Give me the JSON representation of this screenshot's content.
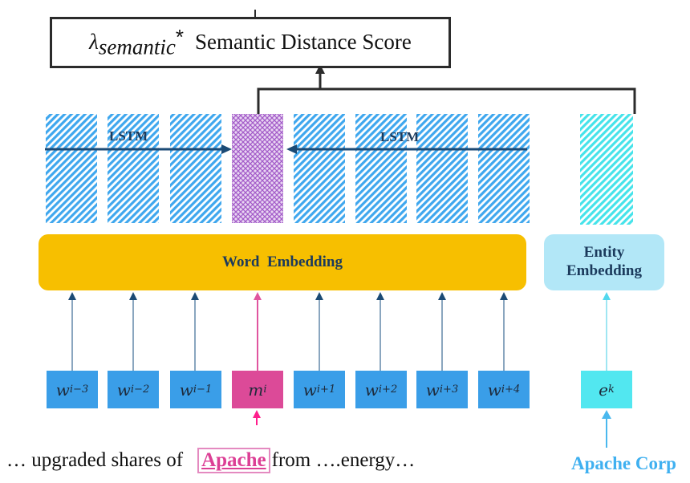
{
  "score": {
    "lambda_symbol": "λ",
    "lambda_subscript": "semantic",
    "operator": "*",
    "label": "Semantic Distance Score"
  },
  "lstm": {
    "forward_label": "LSTM",
    "backward_label": "LSTM",
    "cell_count": 8,
    "mention_cell_index": 3
  },
  "embeddings": {
    "word": "Word  Embedding",
    "entity_line1": "Entity",
    "entity_line2": "Embedding"
  },
  "tokens": [
    {
      "base": "w",
      "sub": "i−3",
      "kind": "word"
    },
    {
      "base": "w",
      "sub": "i−2",
      "kind": "word"
    },
    {
      "base": "w",
      "sub": "i−1",
      "kind": "word"
    },
    {
      "base": "m",
      "sub": "i",
      "kind": "mention"
    },
    {
      "base": "w",
      "sub": "i+1",
      "kind": "word"
    },
    {
      "base": "w",
      "sub": "i+2",
      "kind": "word"
    },
    {
      "base": "w",
      "sub": "i+3",
      "kind": "word"
    },
    {
      "base": "w",
      "sub": "i+4",
      "kind": "word"
    }
  ],
  "entity_token": {
    "base": "e",
    "sub": "k"
  },
  "sentence": {
    "prefix": "… upgraded shares of",
    "mention": "Apache",
    "suffix": "from ….energy…"
  },
  "entity_name": "Apache Corp",
  "colors": {
    "word_hatch": "#3fa7ee",
    "mention_hatch": "#a35cc9",
    "entity_hatch": "#45e3ea",
    "word_embedding": "#f7bf00",
    "entity_embedding": "#b2e7f7",
    "arrow_dark": "#1b4a75",
    "arrow_mention": "#e0559f",
    "arrow_entity": "#52d8ee",
    "connector": "#2b2b2b"
  }
}
